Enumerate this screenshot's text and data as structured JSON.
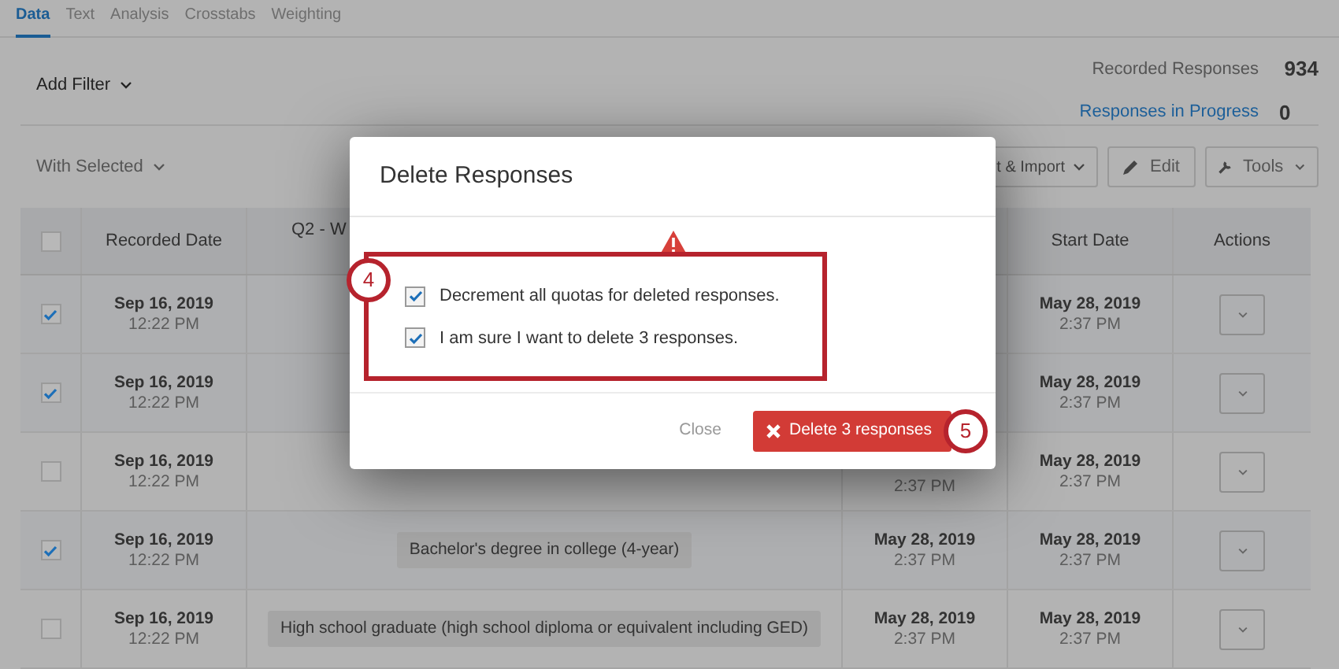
{
  "tabs": [
    {
      "label": "Data",
      "selected": true
    },
    {
      "label": "Text",
      "selected": false
    },
    {
      "label": "Analysis",
      "selected": false
    },
    {
      "label": "Crosstabs",
      "selected": false
    },
    {
      "label": "Weighting",
      "selected": false
    }
  ],
  "filter": {
    "label": "Add Filter"
  },
  "stats": {
    "recorded_label": "Recorded Responses",
    "recorded_value": "934",
    "progress_label": "Responses in Progress",
    "progress_value": "0"
  },
  "toolbar": {
    "with_selected": "With Selected",
    "export_import": "t & Import",
    "edit": "Edit",
    "tools": "Tools"
  },
  "table": {
    "select_all_checked": false,
    "columns": [
      "Recorded Date",
      "Q2 - W",
      "Start Date",
      "Actions"
    ],
    "rows": [
      {
        "checked": true,
        "recorded_date": "Sep 16, 2019",
        "recorded_time": "12:22 PM",
        "start_date": "May 28, 2019",
        "start_time": "2:37 PM"
      },
      {
        "checked": true,
        "recorded_date": "Sep 16, 2019",
        "recorded_time": "12:22 PM",
        "start_date": "May 28, 2019",
        "start_time": "2:37 PM"
      },
      {
        "checked": false,
        "recorded_date": "Sep 16, 2019",
        "recorded_time": "12:22 PM",
        "column_4_time": "2:37 PM",
        "start_date": "May 28, 2019",
        "start_time": "2:37 PM"
      },
      {
        "checked": true,
        "recorded_date": "Sep 16, 2019",
        "recorded_time": "12:22 PM",
        "answer": "Bachelor's degree in college (4-year)",
        "column_4_date": "May 28, 2019",
        "column_4_time": "2:37 PM",
        "start_date": "May 28, 2019",
        "start_time": "2:37 PM"
      },
      {
        "checked": false,
        "recorded_date": "Sep 16, 2019",
        "recorded_time": "12:22 PM",
        "answer": "High school graduate (high school diploma or equivalent including GED)",
        "column_4_date": "May 28, 2019",
        "column_4_time": "2:37 PM",
        "start_date": "May 28, 2019",
        "start_time": "2:37 PM"
      }
    ]
  },
  "dialog": {
    "title": "Delete Responses",
    "options": [
      {
        "label": "Decrement all quotas for deleted responses.",
        "checked": true
      },
      {
        "label": "I am sure I want to delete 3 responses.",
        "checked": true
      }
    ],
    "close": "Close",
    "delete": "Delete 3 responses"
  },
  "callouts": [
    "4",
    "5"
  ]
}
